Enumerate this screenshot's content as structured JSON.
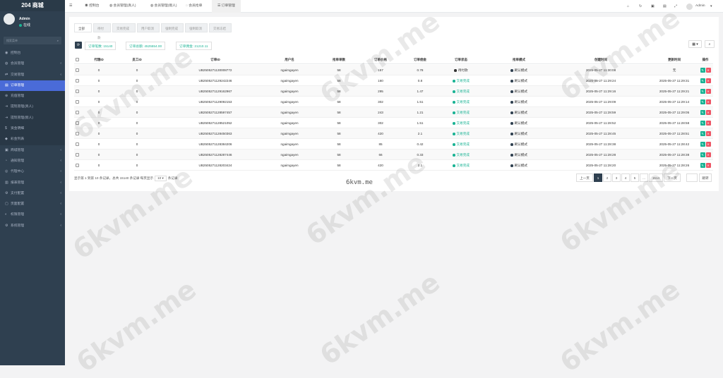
{
  "brand": "204 商城",
  "user": {
    "name": "Admin",
    "status": "在线"
  },
  "search": {
    "placeholder": "搜索菜单"
  },
  "menu": [
    {
      "icon": "dashboard-icon",
      "label": "控制台",
      "arrow": false,
      "state": ""
    },
    {
      "icon": "users-icon",
      "label": "会员管理",
      "arrow": true,
      "state": ""
    },
    {
      "icon": "exchange-icon",
      "label": "交易管理",
      "arrow": true,
      "state": ""
    },
    {
      "icon": "order-icon",
      "label": "订单管理",
      "arrow": false,
      "state": "active"
    },
    {
      "icon": "recharge-icon",
      "label": "充值管理",
      "arrow": false,
      "state": "sub"
    },
    {
      "icon": "withdraw-icon",
      "label": "提现管理(真人)",
      "arrow": false,
      "state": "sub"
    },
    {
      "icon": "withdraw-icon",
      "label": "提现管理(假人)",
      "arrow": false,
      "state": "sub"
    },
    {
      "icon": "fund-icon",
      "label": "资金明细",
      "arrow": false,
      "state": "sub"
    },
    {
      "icon": "gold-icon",
      "label": "彩金列表",
      "arrow": false,
      "state": "sub"
    },
    {
      "icon": "shop-icon",
      "label": "商城管理",
      "arrow": true,
      "state": ""
    },
    {
      "icon": "bell-icon",
      "label": "通知管理",
      "arrow": true,
      "state": ""
    },
    {
      "icon": "agent-icon",
      "label": "代理中心",
      "arrow": true,
      "state": ""
    },
    {
      "icon": "report-icon",
      "label": "报表管理",
      "arrow": true,
      "state": ""
    },
    {
      "icon": "cog-icon",
      "label": "支付配置",
      "arrow": true,
      "state": ""
    },
    {
      "icon": "page-icon",
      "label": "页面配置",
      "arrow": true,
      "state": ""
    },
    {
      "icon": "perm-icon",
      "label": "权限管理",
      "arrow": true,
      "state": ""
    },
    {
      "icon": "system-icon",
      "label": "系统管理",
      "arrow": true,
      "state": ""
    }
  ],
  "topbar": {
    "menu_icon": "☰",
    "tabs": [
      {
        "label": "控制台",
        "icon": "dashboard-icon"
      },
      {
        "label": "会员管理(真人)",
        "icon": "user-icon"
      },
      {
        "label": "会员管理(假人)",
        "icon": "user-icon"
      },
      {
        "label": "会员抢单",
        "icon": "list-icon"
      },
      {
        "label": "订单管理",
        "icon": "list-icon"
      }
    ],
    "admin": "Admin"
  },
  "filter_tabs": [
    "全部",
    "待付款",
    "交易完成",
    "用户取消",
    "强制完成",
    "强制取消",
    "交易冻结"
  ],
  "stats": [
    {
      "label": "订单笔数:",
      "value": "15140"
    },
    {
      "label": "订单总额:",
      "value": "4525554.00"
    },
    {
      "label": "订单佣金:",
      "value": "21210.11"
    }
  ],
  "table": {
    "headers": [
      "代理ID",
      "员工ID",
      "订单ID",
      "用户名",
      "抢单单数",
      "订单价格",
      "订单佣金",
      "订单状态",
      "抢单模式",
      "创建时间",
      "更新时间",
      "操作"
    ],
    "rows": [
      [
        "0",
        "0",
        "UB2505271130008772",
        "ngaimgayen",
        "58",
        "157",
        "0.78",
        "待付款",
        "刷认模式",
        "2025-05-27 11:30:08",
        "无"
      ],
      [
        "0",
        "0",
        "UB2505271129242246",
        "ngaimgayen",
        "58",
        "160",
        "0.8",
        "交易完成",
        "刷认模式",
        "2025-05-27 11:29:24",
        "2025-05-27 11:29:31"
      ],
      [
        "0",
        "0",
        "UB2505271129162967",
        "ngaimgayen",
        "58",
        "295",
        "1.47",
        "交易完成",
        "刷认模式",
        "2025-05-27 11:29:16",
        "2025-05-27 11:29:21"
      ],
      [
        "0",
        "0",
        "UB2505271129092153",
        "ngaimgayen",
        "58",
        "302",
        "1.51",
        "交易完成",
        "刷认模式",
        "2025-05-27 11:29:09",
        "2025-05-27 11:29:14"
      ],
      [
        "0",
        "0",
        "UB2505271128597457",
        "ngaimgayen",
        "58",
        "243",
        "1.21",
        "交易完成",
        "刷认模式",
        "2025-05-27 11:28:59",
        "2025-05-27 11:29:05"
      ],
      [
        "0",
        "0",
        "UB2505271128521052",
        "ngaimgayen",
        "58",
        "302",
        "1.51",
        "交易完成",
        "刷认模式",
        "2025-05-27 11:28:52",
        "2025-05-27 11:28:58"
      ],
      [
        "0",
        "0",
        "UB2505271128450363",
        "ngaimgayen",
        "58",
        "420",
        "2.1",
        "交易完成",
        "刷认模式",
        "2025-05-27 11:28:45",
        "2025-05-27 11:28:51"
      ],
      [
        "0",
        "0",
        "UB2505271128384206",
        "ngaimgayen",
        "58",
        "85",
        "0.42",
        "交易完成",
        "刷认模式",
        "2025-05-27 11:28:38",
        "2025-05-27 11:28:42"
      ],
      [
        "0",
        "0",
        "UB2505271128287446",
        "ngaimgayen",
        "58",
        "66",
        "0.33",
        "交易完成",
        "刷认模式",
        "2025-05-27 11:28:28",
        "2025-05-27 11:28:38"
      ],
      [
        "0",
        "0",
        "UB2505271128203424",
        "ngaimgayen",
        "58",
        "420",
        "2.1",
        "交易完成",
        "刷认模式",
        "2025-05-27 11:28:20",
        "2025-05-27 11:28:26"
      ]
    ]
  },
  "footer": {
    "text1": "显示第 1 到第 10 条记录，总共 15140 条记录 每页显示",
    "page_size": "10 ▾",
    "text2": "条记录"
  },
  "pagination": [
    "上一页",
    "1",
    "2",
    "3",
    "4",
    "5",
    "...",
    "1514",
    "下一页"
  ],
  "jump_label": "跳转",
  "watermark": "6kvm.me",
  "colors": {
    "sidebar": "#2f4050",
    "active_menu": "#4a6bd8",
    "success": "#1ab394",
    "danger": "#ed5565"
  }
}
